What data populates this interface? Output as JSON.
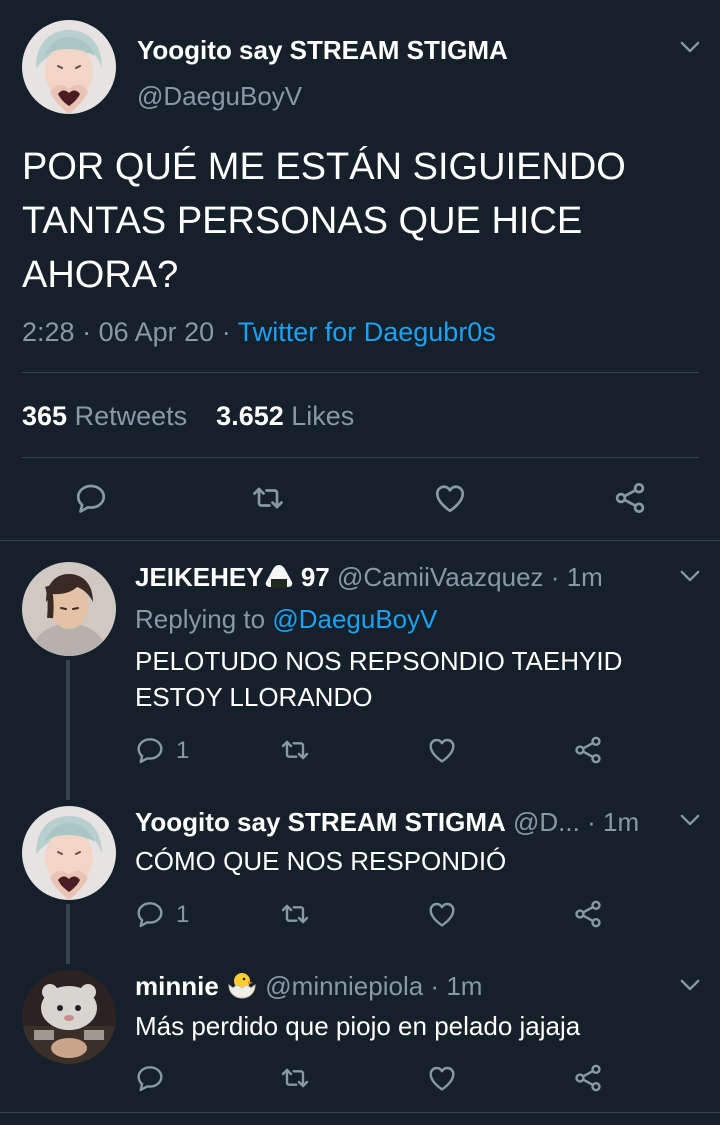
{
  "main_tweet": {
    "display_name": "Yoogito say STREAM STIGMA",
    "handle": "@DaeguBoyV",
    "text_lines": [
      "POR QUÉ ME ESTÁN SIGUIENDO",
      "TANTAS PERSONAS QUE HICE",
      "AHORA?"
    ],
    "time": "2:28",
    "sep": "·",
    "date": "06 Apr 20",
    "source": "Twitter for Daegubr0s",
    "retweets_count": "365",
    "retweets_label": "Retweets",
    "likes_count": "3.652",
    "likes_label": "Likes"
  },
  "replies": [
    {
      "display_name": "JEIKEHEY",
      "name_suffix": "97",
      "handle": "@CamiiVaazquez",
      "sep": "·",
      "time": "1m",
      "replying_prefix": "Replying to",
      "replying_to": "@DaeguBoyV",
      "text_lines": [
        "PELOTUDO NOS REPSONDIO TAEHYID",
        "ESTOY LLORANDO"
      ],
      "reply_count": "1"
    },
    {
      "display_name": "Yoogito say STREAM STIGMA",
      "handle": "@D...",
      "sep": "·",
      "time": "1m",
      "text_lines": [
        "CÓMO QUE NOS RESPONDIÓ"
      ],
      "reply_count": "1"
    },
    {
      "display_name": "minnie",
      "handle": "@minniepiola",
      "sep": "·",
      "time": "1m",
      "text_lines": [
        "Más perdido que piojo en pelado jajaja"
      ]
    }
  ],
  "colors": {
    "background": "#15202b",
    "text": "#ffffff",
    "secondary": "#8899a6",
    "accent": "#1da1f2",
    "divider": "#38444d"
  },
  "icons": [
    "chevron-down-icon",
    "reply-icon",
    "retweet-icon",
    "like-icon",
    "share-icon",
    "rice-ball-emoji",
    "hatching-chick-emoji"
  ]
}
